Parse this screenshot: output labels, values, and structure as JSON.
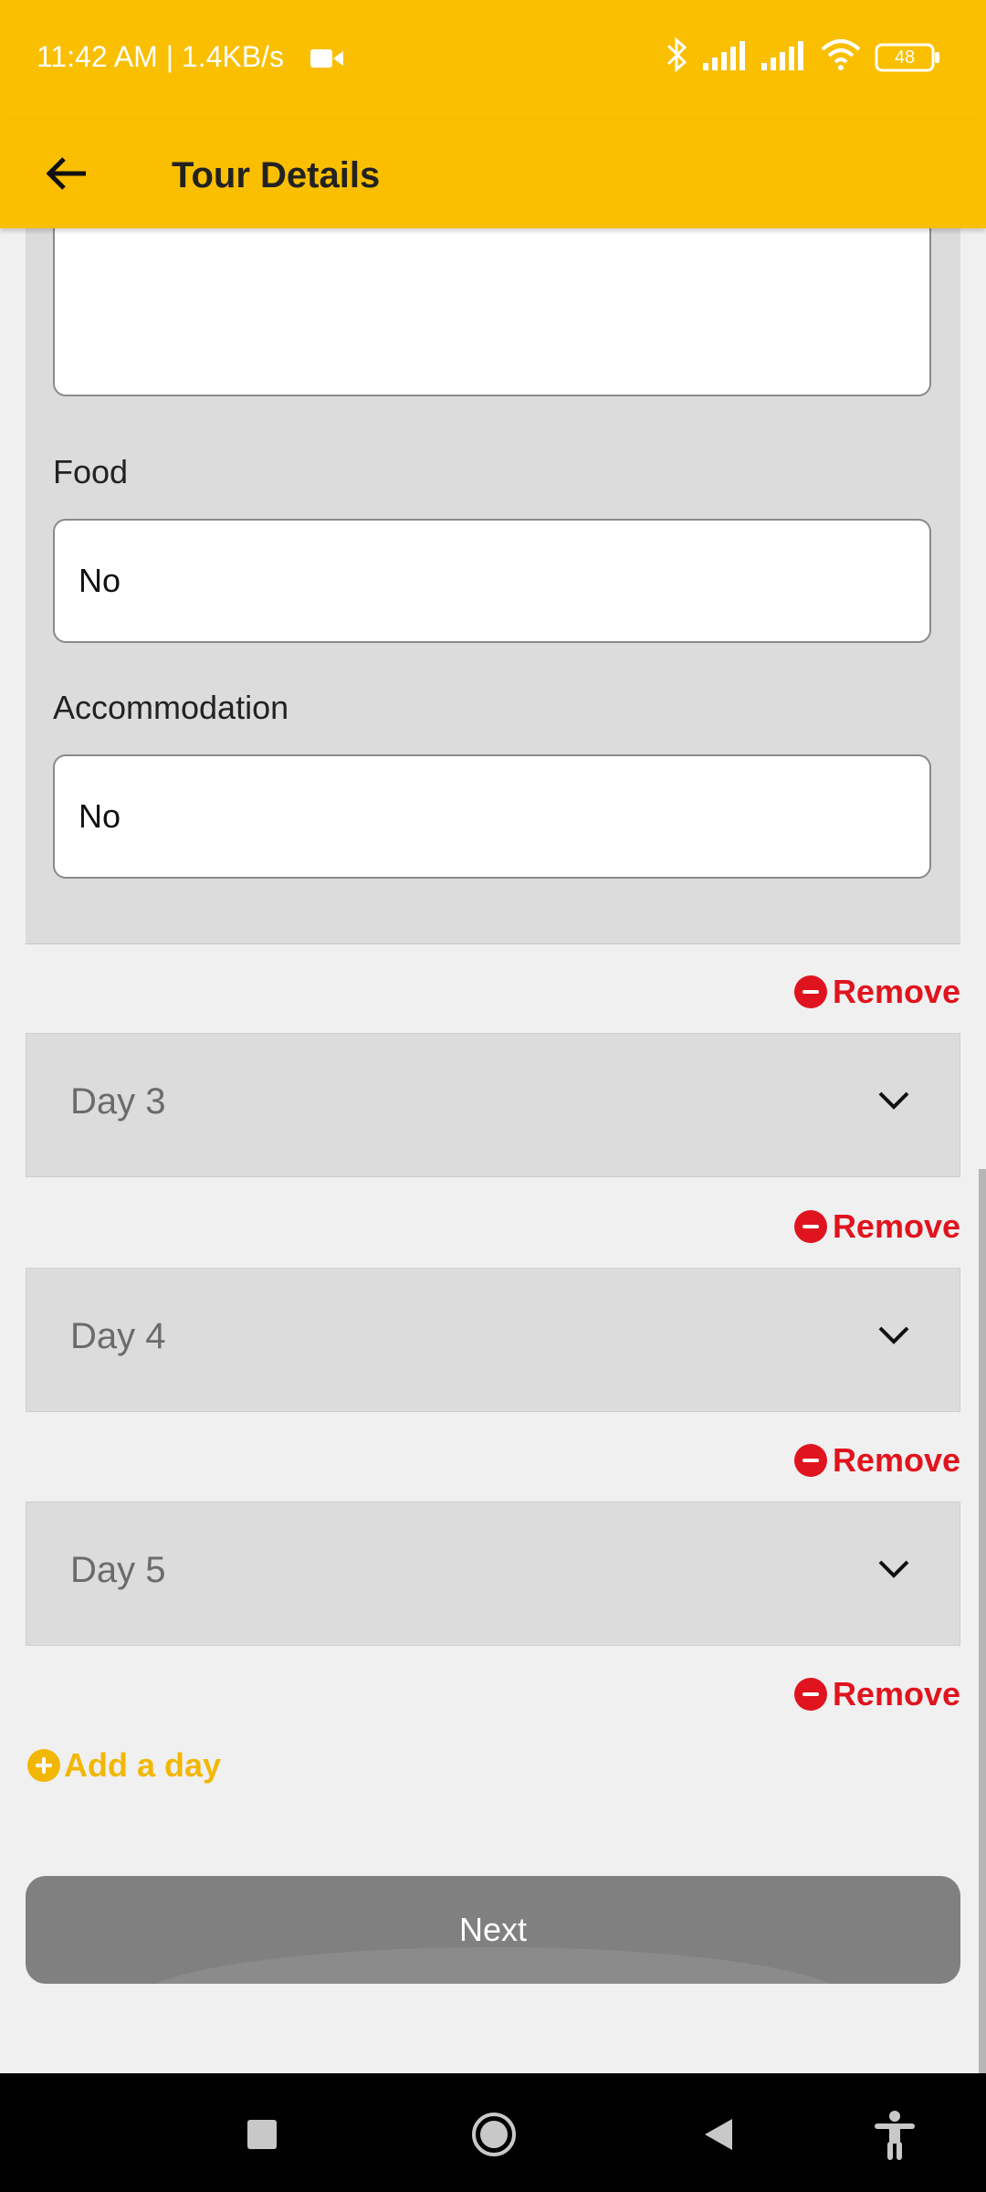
{
  "status_bar": {
    "time_speed": "11:42 AM | 1.4KB/s",
    "battery": "48",
    "icons": [
      "video-icon",
      "bluetooth-icon",
      "signal-icon",
      "signal-icon",
      "wifi-icon",
      "battery-icon"
    ]
  },
  "app_bar": {
    "title": "Tour Details",
    "back_icon": "arrow-left-icon"
  },
  "day_panel": {
    "food_label": "Food",
    "food_value": "No",
    "accommodation_label": "Accommodation",
    "accommodation_value": "No"
  },
  "remove_label": "Remove",
  "days": [
    {
      "label": "Day 3"
    },
    {
      "label": "Day 4"
    },
    {
      "label": "Day 5"
    }
  ],
  "add_day_label": "Add a day",
  "next_label": "Next",
  "colors": {
    "accent": "#f9bf00",
    "remove": "#e0141e",
    "add": "#f2b705",
    "button_disabled": "#808080"
  },
  "nav_bar": {
    "icons": [
      "recents-square-icon",
      "home-circle-icon",
      "back-triangle-icon",
      "accessibility-icon"
    ]
  }
}
